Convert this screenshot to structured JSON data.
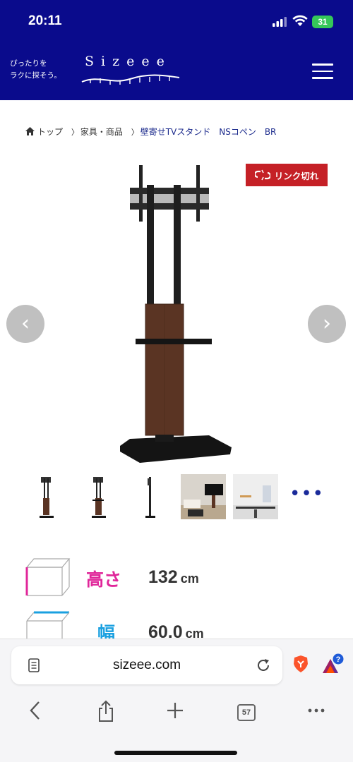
{
  "status_bar": {
    "time": "20:11",
    "battery": "31"
  },
  "header": {
    "tagline_line1": "ぴったりを",
    "tagline_line2": "ラクに探そう。",
    "logo": "Sizeee",
    "brand_color": "#0a0b8c"
  },
  "breadcrumb": {
    "home": "トップ",
    "category": "家具・商品",
    "current": "壁寄せTVスタンド　NSコペン　BR"
  },
  "product": {
    "link_badge": "リンク切れ",
    "badge_color": "#c52026",
    "prev_label": "‹",
    "next_label": "›",
    "thumbnails": [
      "tv-stand-front",
      "tv-stand-angle",
      "tv-stand-side",
      "room-photo-1",
      "room-photo-2"
    ],
    "more_label": "•••"
  },
  "specs": [
    {
      "label": "高さ",
      "value": "132",
      "unit": "cm",
      "color": "#e0269a"
    },
    {
      "label": "幅",
      "value": "60.0",
      "unit": "cm",
      "color": "#1aa0e0"
    }
  ],
  "browser": {
    "url": "sizeee.com",
    "tab_count": "57",
    "badge": "?"
  }
}
